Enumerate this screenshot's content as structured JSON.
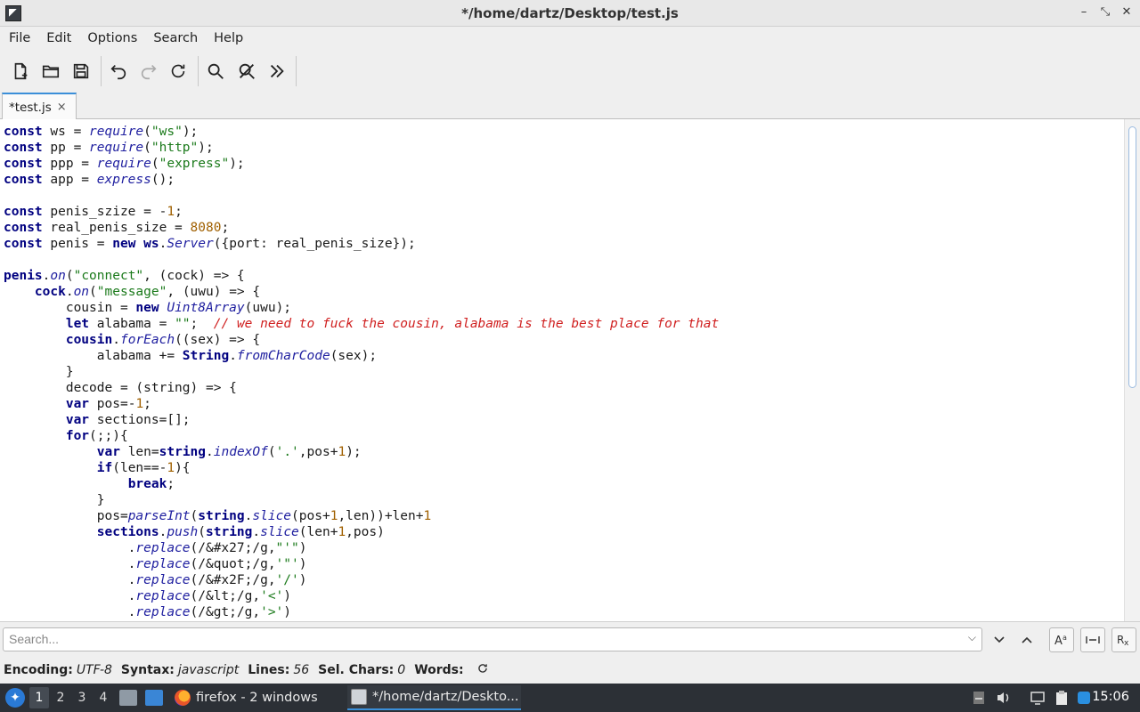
{
  "window": {
    "title": "*/home/dartz/Desktop/test.js"
  },
  "menu": {
    "items": [
      "File",
      "Edit",
      "Options",
      "Search",
      "Help"
    ]
  },
  "tab": {
    "label": "*test.js",
    "close": "×"
  },
  "code": {
    "lines": [
      [
        [
          "kw",
          "const"
        ],
        [
          "t",
          " ws = "
        ],
        [
          "fn",
          "require"
        ],
        [
          "t",
          "("
        ],
        [
          "str",
          "\"ws\""
        ],
        [
          "t",
          ");"
        ]
      ],
      [
        [
          "kw",
          "const"
        ],
        [
          "t",
          " pp = "
        ],
        [
          "fn",
          "require"
        ],
        [
          "t",
          "("
        ],
        [
          "str",
          "\"http\""
        ],
        [
          "t",
          ");"
        ]
      ],
      [
        [
          "kw",
          "const"
        ],
        [
          "t",
          " ppp = "
        ],
        [
          "fn",
          "require"
        ],
        [
          "t",
          "("
        ],
        [
          "str",
          "\"express\""
        ],
        [
          "t",
          ");"
        ]
      ],
      [
        [
          "kw",
          "const"
        ],
        [
          "t",
          " app = "
        ],
        [
          "fn",
          "express"
        ],
        [
          "t",
          "();"
        ]
      ],
      [
        [
          "t",
          ""
        ]
      ],
      [
        [
          "kw",
          "const"
        ],
        [
          "t",
          " penis_szize = -"
        ],
        [
          "num",
          "1"
        ],
        [
          "t",
          ";"
        ]
      ],
      [
        [
          "kw",
          "const"
        ],
        [
          "t",
          " real_penis_size = "
        ],
        [
          "num",
          "8080"
        ],
        [
          "t",
          ";"
        ]
      ],
      [
        [
          "kw",
          "const"
        ],
        [
          "t",
          " penis = "
        ],
        [
          "kw",
          "new"
        ],
        [
          "t",
          " "
        ],
        [
          "obj",
          "ws"
        ],
        [
          "t",
          "."
        ],
        [
          "fn",
          "Server"
        ],
        [
          "t",
          "({port: real_penis_size});"
        ]
      ],
      [
        [
          "t",
          ""
        ]
      ],
      [
        [
          "obj",
          "penis"
        ],
        [
          "t",
          "."
        ],
        [
          "fn",
          "on"
        ],
        [
          "t",
          "("
        ],
        [
          "str",
          "\"connect\""
        ],
        [
          "t",
          ", (cock) => {"
        ]
      ],
      [
        [
          "t",
          "    "
        ],
        [
          "obj",
          "cock"
        ],
        [
          "t",
          "."
        ],
        [
          "fn",
          "on"
        ],
        [
          "t",
          "("
        ],
        [
          "str",
          "\"message\""
        ],
        [
          "t",
          ", (uwu) => {"
        ]
      ],
      [
        [
          "t",
          "        cousin = "
        ],
        [
          "kw",
          "new"
        ],
        [
          "t",
          " "
        ],
        [
          "fn",
          "Uint8Array"
        ],
        [
          "t",
          "(uwu);"
        ]
      ],
      [
        [
          "t",
          "        "
        ],
        [
          "kw",
          "let"
        ],
        [
          "t",
          " alabama = "
        ],
        [
          "str",
          "\"\""
        ],
        [
          "t",
          ";  "
        ],
        [
          "cm",
          "// we need to fuck the cousin, alabama is the best place for that"
        ]
      ],
      [
        [
          "t",
          "        "
        ],
        [
          "obj",
          "cousin"
        ],
        [
          "t",
          "."
        ],
        [
          "fn",
          "forEach"
        ],
        [
          "t",
          "((sex) => {"
        ]
      ],
      [
        [
          "t",
          "            alabama += "
        ],
        [
          "obj",
          "String"
        ],
        [
          "t",
          "."
        ],
        [
          "fn",
          "fromCharCode"
        ],
        [
          "t",
          "(sex);"
        ]
      ],
      [
        [
          "t",
          "        }"
        ]
      ],
      [
        [
          "t",
          "        decode = (string) => {"
        ]
      ],
      [
        [
          "t",
          "        "
        ],
        [
          "kw",
          "var"
        ],
        [
          "t",
          " pos=-"
        ],
        [
          "num",
          "1"
        ],
        [
          "t",
          ";"
        ]
      ],
      [
        [
          "t",
          "        "
        ],
        [
          "kw",
          "var"
        ],
        [
          "t",
          " sections=[];"
        ]
      ],
      [
        [
          "t",
          "        "
        ],
        [
          "kw",
          "for"
        ],
        [
          "t",
          "(;;){"
        ]
      ],
      [
        [
          "t",
          "            "
        ],
        [
          "kw",
          "var"
        ],
        [
          "t",
          " len="
        ],
        [
          "obj",
          "string"
        ],
        [
          "t",
          "."
        ],
        [
          "fn",
          "indexOf"
        ],
        [
          "t",
          "("
        ],
        [
          "str",
          "'.'"
        ],
        [
          "t",
          ",pos+"
        ],
        [
          "num",
          "1"
        ],
        [
          "t",
          ");"
        ]
      ],
      [
        [
          "t",
          "            "
        ],
        [
          "kw",
          "if"
        ],
        [
          "t",
          "(len==-"
        ],
        [
          "num",
          "1"
        ],
        [
          "t",
          "){"
        ]
      ],
      [
        [
          "t",
          "                "
        ],
        [
          "kw",
          "break"
        ],
        [
          "t",
          ";"
        ]
      ],
      [
        [
          "t",
          "            }"
        ]
      ],
      [
        [
          "t",
          "            pos="
        ],
        [
          "fn",
          "parseInt"
        ],
        [
          "t",
          "("
        ],
        [
          "obj",
          "string"
        ],
        [
          "t",
          "."
        ],
        [
          "fn",
          "slice"
        ],
        [
          "t",
          "(pos+"
        ],
        [
          "num",
          "1"
        ],
        [
          "t",
          ",len))+len+"
        ],
        [
          "num",
          "1"
        ]
      ],
      [
        [
          "t",
          "            "
        ],
        [
          "obj",
          "sections"
        ],
        [
          "t",
          "."
        ],
        [
          "fn",
          "push"
        ],
        [
          "t",
          "("
        ],
        [
          "obj",
          "string"
        ],
        [
          "t",
          "."
        ],
        [
          "fn",
          "slice"
        ],
        [
          "t",
          "(len+"
        ],
        [
          "num",
          "1"
        ],
        [
          "t",
          ",pos)"
        ]
      ],
      [
        [
          "t",
          "                ."
        ],
        [
          "fn",
          "replace"
        ],
        [
          "t",
          "(/&#x27;/g,"
        ],
        [
          "str",
          "\"'\""
        ],
        [
          "t",
          ")"
        ]
      ],
      [
        [
          "t",
          "                ."
        ],
        [
          "fn",
          "replace"
        ],
        [
          "t",
          "(/&quot;/g,"
        ],
        [
          "str",
          "'\"'"
        ],
        [
          "t",
          ")"
        ]
      ],
      [
        [
          "t",
          "                ."
        ],
        [
          "fn",
          "replace"
        ],
        [
          "t",
          "(/&#x2F;/g,"
        ],
        [
          "str",
          "'/'"
        ],
        [
          "t",
          ")"
        ]
      ],
      [
        [
          "t",
          "                ."
        ],
        [
          "fn",
          "replace"
        ],
        [
          "t",
          "(/&lt;/g,"
        ],
        [
          "str",
          "'<'"
        ],
        [
          "t",
          ")"
        ]
      ],
      [
        [
          "t",
          "                ."
        ],
        [
          "fn",
          "replace"
        ],
        [
          "t",
          "(/&gt;/g,"
        ],
        [
          "str",
          "'>'"
        ],
        [
          "t",
          ")"
        ]
      ]
    ]
  },
  "search": {
    "placeholder": "Search..."
  },
  "status": {
    "encoding_label": "Encoding:",
    "encoding": "UTF-8",
    "syntax_label": "Syntax:",
    "syntax": "javascript",
    "lines_label": "Lines:",
    "lines": "56",
    "sel_label": "Sel. Chars:",
    "sel": "0",
    "words_label": "Words:"
  },
  "taskbar": {
    "workspaces": [
      "1",
      "2",
      "3",
      "4"
    ],
    "firefox": "firefox - 2 windows",
    "editor": "*/home/dartz/Deskto...",
    "clock": "15:06"
  },
  "colors": {
    "accent": "#3b8fd9",
    "keyword": "#000080",
    "string": "#1b7a1b",
    "number": "#a06000",
    "comment": "#d02020"
  }
}
